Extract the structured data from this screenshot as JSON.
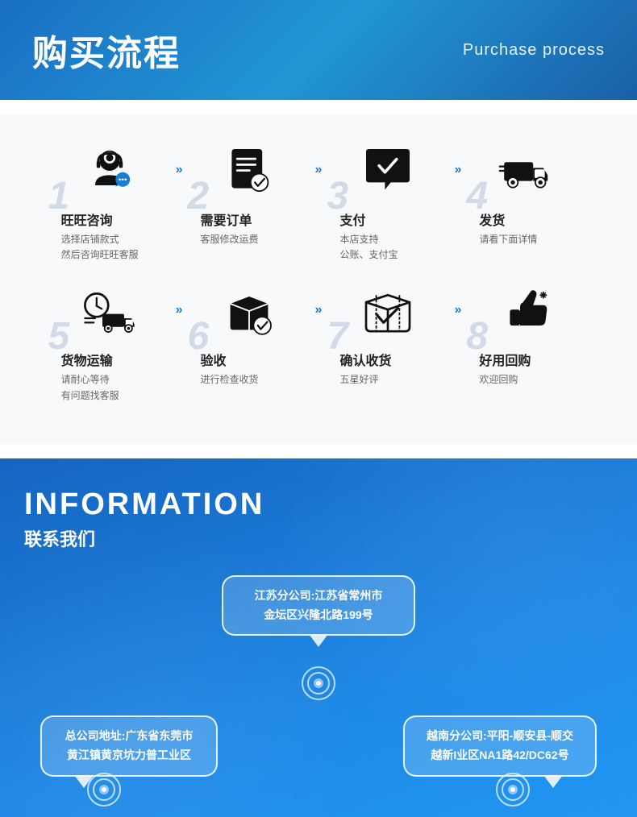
{
  "header": {
    "title_cn": "购买流程",
    "title_en": "Purchase process"
  },
  "process": {
    "row1": [
      {
        "number": "1",
        "title": "旺旺咨询",
        "desc": "选择店铺款式\n然后咨询旺旺客服"
      },
      {
        "number": "2",
        "title": "需要订单",
        "desc": "客服修改运费"
      },
      {
        "number": "3",
        "title": "支付",
        "desc": "本店支持\n公账、支付宝"
      },
      {
        "number": "4",
        "title": "发货",
        "desc": "请看下面详情"
      }
    ],
    "row2": [
      {
        "number": "5",
        "title": "货物运输",
        "desc": "请耐心等待\n有问题找客服"
      },
      {
        "number": "6",
        "title": "验收",
        "desc": "进行检查收货"
      },
      {
        "number": "7",
        "title": "确认收货",
        "desc": "五星好评"
      },
      {
        "number": "8",
        "title": "好用回购",
        "desc": "欢迎回购"
      }
    ],
    "arrow": "»"
  },
  "info": {
    "title_en": "INFORMATION",
    "title_cn": "联系我们",
    "jiangsu": "江苏分公司:江苏省常州市\n金坛区兴隆北路199号",
    "guangdong": "总公司地址:广东省东莞市\n黄江镇黄京坑力普工业区",
    "vietnam": "越南分公司:平阳-顺安县-顺交\n越新I业区NA1路42/DC62号"
  }
}
